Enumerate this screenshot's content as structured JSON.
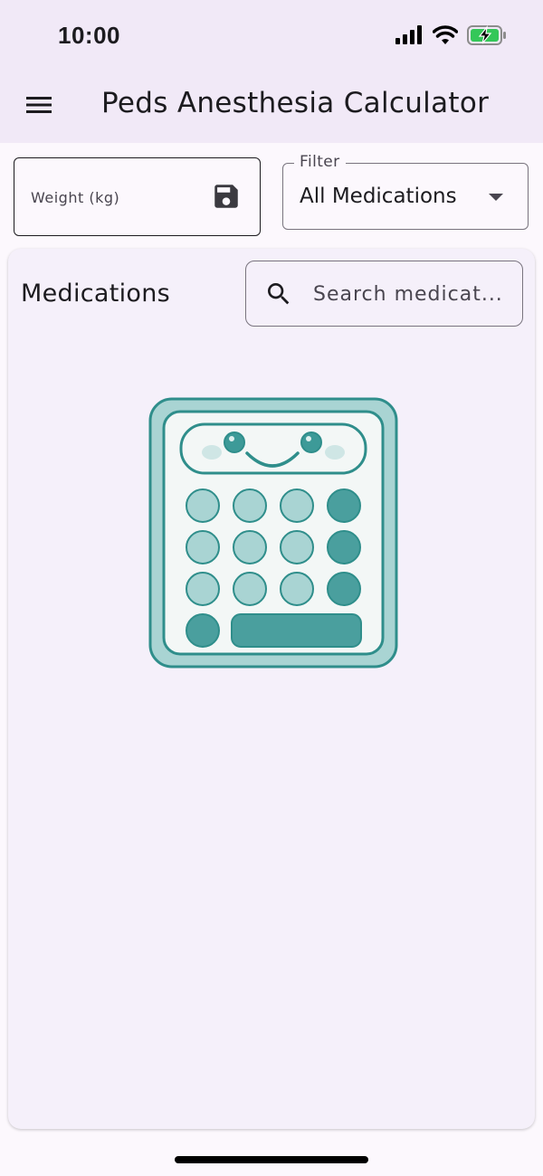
{
  "status_bar": {
    "time": "10:00",
    "icons": [
      "cellular-signal-icon",
      "wifi-icon",
      "battery-charging-icon"
    ]
  },
  "app_bar": {
    "menu_icon": "menu-icon",
    "title": "Peds Anesthesia Calculator"
  },
  "weight_input": {
    "placeholder": "Weight (kg)",
    "value": "",
    "action_icon": "save-icon"
  },
  "filter": {
    "label": "Filter",
    "selected": "All Medications",
    "icon": "arrow-drop-down-icon"
  },
  "medications": {
    "title": "Medications",
    "search_placeholder": "Search medicat...",
    "search_icon": "search-icon",
    "empty_state_illustration": "calculator-mascot"
  },
  "colors": {
    "app_bar_bg": "#f1e9f7",
    "page_bg": "#fcf8fd",
    "card_bg": "#f5f0fa",
    "teal_dark": "#4a9f9e",
    "teal_light": "#a9d4d3",
    "teal_outline": "#2f8e8b"
  }
}
